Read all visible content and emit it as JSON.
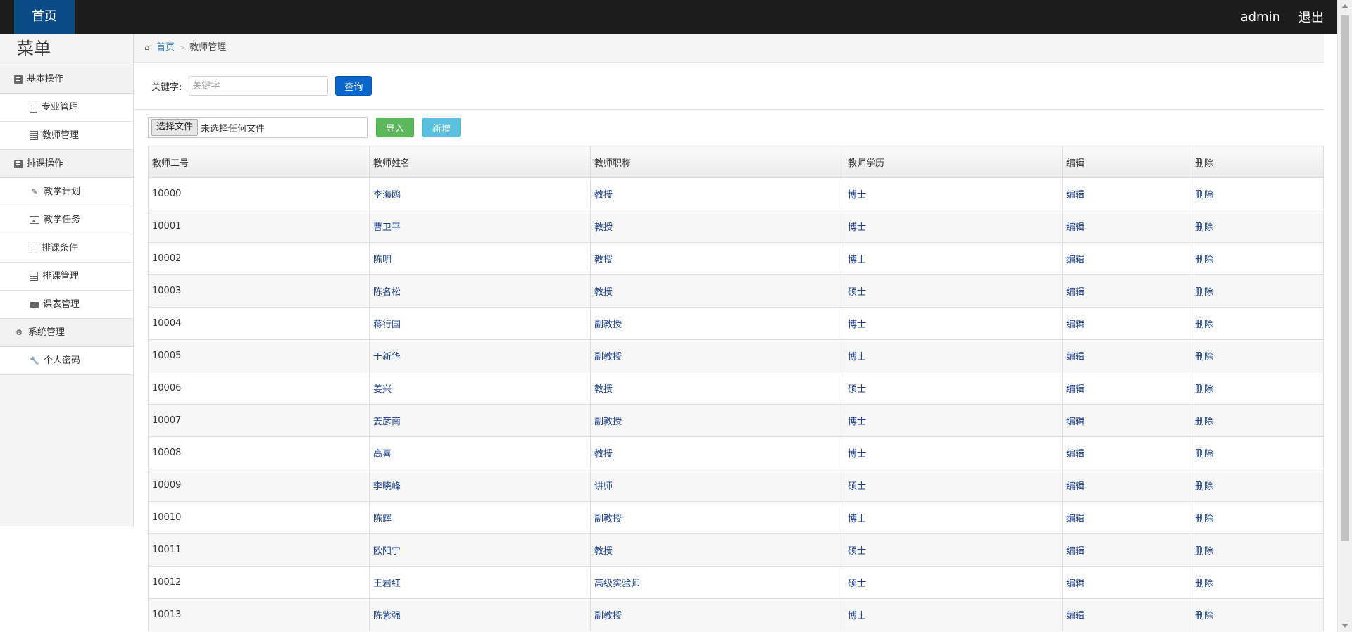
{
  "topbar": {
    "home": "首页",
    "user": "admin",
    "logout": "退出"
  },
  "sidebar": {
    "title": "菜单",
    "groups": [
      {
        "label": "基本操作",
        "icon": "book-icon",
        "items": [
          {
            "label": "专业管理",
            "icon": "file-icon"
          },
          {
            "label": "教师管理",
            "icon": "list-icon"
          }
        ]
      },
      {
        "label": "排课操作",
        "icon": "book-icon",
        "items": [
          {
            "label": "教学计划",
            "icon": "leaf-icon"
          },
          {
            "label": "教学任务",
            "icon": "picture-icon"
          },
          {
            "label": "排课条件",
            "icon": "file-icon"
          },
          {
            "label": "排课管理",
            "icon": "list-icon"
          },
          {
            "label": "课表管理",
            "icon": "truck-icon"
          }
        ]
      },
      {
        "label": "系统管理",
        "icon": "gear-icon",
        "items": [
          {
            "label": "个人密码",
            "icon": "wrench-icon"
          }
        ]
      }
    ]
  },
  "breadcrumb": {
    "home": "首页",
    "current": "教师管理"
  },
  "search": {
    "label": "关键字:",
    "placeholder": "关键字",
    "button": "查询"
  },
  "toolbar": {
    "choose_file": "选择文件",
    "no_file": "未选择任何文件",
    "import": "导入",
    "add": "新增"
  },
  "table": {
    "headers": [
      "教师工号",
      "教师姓名",
      "教师职称",
      "教师学历",
      "编辑",
      "删除"
    ],
    "rows": [
      [
        "10000",
        "李海鸥",
        "教授",
        "博士",
        "编辑",
        "删除"
      ],
      [
        "10001",
        "曹卫平",
        "教授",
        "博士",
        "编辑",
        "删除"
      ],
      [
        "10002",
        "陈明",
        "教授",
        "博士",
        "编辑",
        "删除"
      ],
      [
        "10003",
        "陈名松",
        "教授",
        "硕士",
        "编辑",
        "删除"
      ],
      [
        "10004",
        "蒋行国",
        "副教授",
        "博士",
        "编辑",
        "删除"
      ],
      [
        "10005",
        "于新华",
        "副教授",
        "博士",
        "编辑",
        "删除"
      ],
      [
        "10006",
        "姜兴",
        "教授",
        "硕士",
        "编辑",
        "删除"
      ],
      [
        "10007",
        "姜彦南",
        "副教授",
        "博士",
        "编辑",
        "删除"
      ],
      [
        "10008",
        "高喜",
        "教授",
        "博士",
        "编辑",
        "删除"
      ],
      [
        "10009",
        "李晓峰",
        "讲师",
        "硕士",
        "编辑",
        "删除"
      ],
      [
        "10010",
        "陈辉",
        "副教授",
        "博士",
        "编辑",
        "删除"
      ],
      [
        "10011",
        "欧阳宁",
        "教授",
        "硕士",
        "编辑",
        "删除"
      ],
      [
        "10012",
        "王岩红",
        "高级实验师",
        "硕士",
        "编辑",
        "删除"
      ],
      [
        "10013",
        "陈紫强",
        "副教授",
        "博士",
        "编辑",
        "删除"
      ]
    ]
  },
  "colors": {
    "topbar": "#1c1c1c",
    "brand": "#0a4b86",
    "primary": "#0b66c9",
    "success": "#5cb85c",
    "info": "#5bc0de"
  }
}
